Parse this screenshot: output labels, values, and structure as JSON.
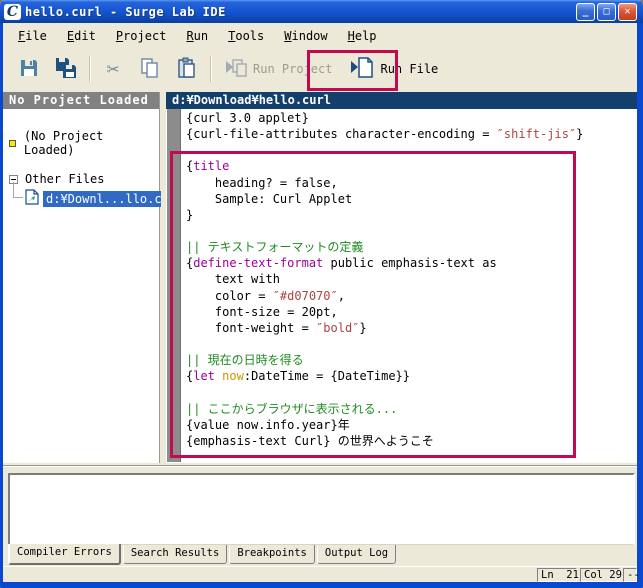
{
  "window": {
    "title": "hello.curl - Surge Lab IDE",
    "controls": {
      "minimize": "_",
      "maximize": "□",
      "close": "✕"
    }
  },
  "menu_bar": {
    "items": [
      {
        "key": "F",
        "rest": "ile"
      },
      {
        "key": "E",
        "rest": "dit"
      },
      {
        "key": "P",
        "rest": "roject"
      },
      {
        "key": "R",
        "rest": "un"
      },
      {
        "key": "T",
        "rest": "ools"
      },
      {
        "key": "W",
        "rest": "indow"
      },
      {
        "key": "H",
        "rest": "elp"
      }
    ]
  },
  "toolbar": {
    "icons": [
      "save-floppy-icon",
      "save-all-floppy-icon",
      "cut-scissors-icon",
      "copy-pages-icon",
      "paste-clipboard-icon",
      "run-project-icon",
      "run-file-icon"
    ],
    "cut_glyph": "✂",
    "run_project_label": "Run Project",
    "run_file_label": "Run File"
  },
  "project_panel": {
    "header": "No Project Loaded",
    "root_item": "(No Project Loaded)",
    "group_item": "Other Files",
    "file_item": "d:¥Downl...llo.curl",
    "selection_color": "#316AC5"
  },
  "editor": {
    "header": "d:¥Download¥hello.curl",
    "colors": {
      "p": "#000000",
      "k": "#990099",
      "s": "#AA4444",
      "c": "#218C21",
      "v": "#C79600"
    },
    "lines": [
      [
        [
          "p",
          "{curl 3.0 applet}"
        ]
      ],
      [
        [
          "p",
          "{curl-file-attributes character-encoding = "
        ],
        [
          "s",
          "″shift-jis″"
        ],
        [
          "p",
          "}"
        ]
      ],
      [],
      [
        [
          "p",
          "{"
        ],
        [
          "k",
          "title"
        ]
      ],
      [
        [
          "p",
          "    heading? = false,"
        ]
      ],
      [
        [
          "p",
          "    Sample: Curl Applet"
        ]
      ],
      [
        [
          "p",
          "}"
        ]
      ],
      [],
      [
        [
          "c",
          "|| テキストフォーマットの定義"
        ]
      ],
      [
        [
          "p",
          "{"
        ],
        [
          "k",
          "define-text-format"
        ],
        [
          "p",
          " public emphasis-text as"
        ]
      ],
      [
        [
          "p",
          "    text with"
        ]
      ],
      [
        [
          "p",
          "    color = "
        ],
        [
          "s",
          "″#d07070″"
        ],
        [
          "p",
          ","
        ]
      ],
      [
        [
          "p",
          "    font-size = 20pt,"
        ]
      ],
      [
        [
          "p",
          "    font-weight = "
        ],
        [
          "s",
          "″bold″"
        ],
        [
          "p",
          "}"
        ]
      ],
      [],
      [
        [
          "c",
          "|| 現在の日時を得る"
        ]
      ],
      [
        [
          "p",
          "{"
        ],
        [
          "k",
          "let"
        ],
        [
          "p",
          " "
        ],
        [
          "v",
          "now"
        ],
        [
          "p",
          ":DateTime = {DateTime}}"
        ]
      ],
      [],
      [
        [
          "c",
          "|| ここからブラウザに表示される..."
        ]
      ],
      [
        [
          "p",
          "{value now.info.year}年"
        ]
      ],
      [
        [
          "p",
          "{emphasis-text Curl} の世界へようこそ"
        ]
      ]
    ]
  },
  "annotations": {
    "color": "#C20A50"
  },
  "output_panel": {
    "content": ""
  },
  "bottom_tabs": {
    "items": [
      {
        "label": "Compiler Errors",
        "active": true
      },
      {
        "label": "Search Results",
        "active": false
      },
      {
        "label": "Breakpoints",
        "active": false
      },
      {
        "label": "Output Log",
        "active": false
      }
    ]
  },
  "status_bar": {
    "ln": "Ln  21",
    "col": "Col 29",
    "grip": "--"
  }
}
